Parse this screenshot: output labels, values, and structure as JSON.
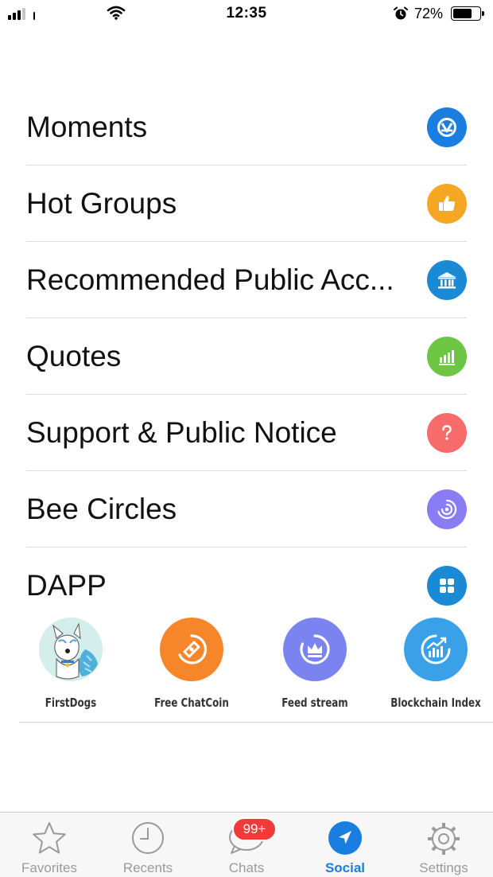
{
  "status_bar": {
    "time": "12:35",
    "battery_percent": "72%",
    "battery_level": 0.72
  },
  "menu": {
    "items": [
      {
        "label": "Moments",
        "icon": "moments-icon",
        "color": "#1a7de0"
      },
      {
        "label": "Hot Groups",
        "icon": "thumbs-up-icon",
        "color": "#f5a623"
      },
      {
        "label": "Recommended Public Acc...",
        "icon": "institution-icon",
        "color": "#1a8ad4"
      },
      {
        "label": "Quotes",
        "icon": "bar-chart-icon",
        "color": "#6cc644"
      },
      {
        "label": "Support & Public Notice",
        "icon": "question-icon",
        "color": "#f76b6b"
      },
      {
        "label": "Bee Circles",
        "icon": "circles-icon",
        "color": "#8a7cf5"
      },
      {
        "label": "DAPP",
        "icon": "grid-icon",
        "color": "#1a8ad4"
      }
    ]
  },
  "dapps": [
    {
      "label": "FirstDogs",
      "icon": "dog-avatar-icon"
    },
    {
      "label": "Free ChatCoin",
      "icon": "coin-icon",
      "color": "#f7862a"
    },
    {
      "label": "Feed stream",
      "icon": "crown-icon",
      "color": "#7b83f0"
    },
    {
      "label": "Blockchain Index",
      "icon": "index-chart-icon",
      "color": "#3aa0e8"
    }
  ],
  "tab_bar": {
    "tabs": [
      {
        "label": "Favorites",
        "icon": "star-icon"
      },
      {
        "label": "Recents",
        "icon": "clock-icon"
      },
      {
        "label": "Chats",
        "icon": "chat-bubble-icon"
      },
      {
        "label": "Social",
        "icon": "location-arrow-icon"
      },
      {
        "label": "Settings",
        "icon": "gear-icon"
      }
    ],
    "active": "Social",
    "chats_badge": "99+",
    "active_color": "#1a7de0",
    "badge_color": "#f23a3a"
  }
}
